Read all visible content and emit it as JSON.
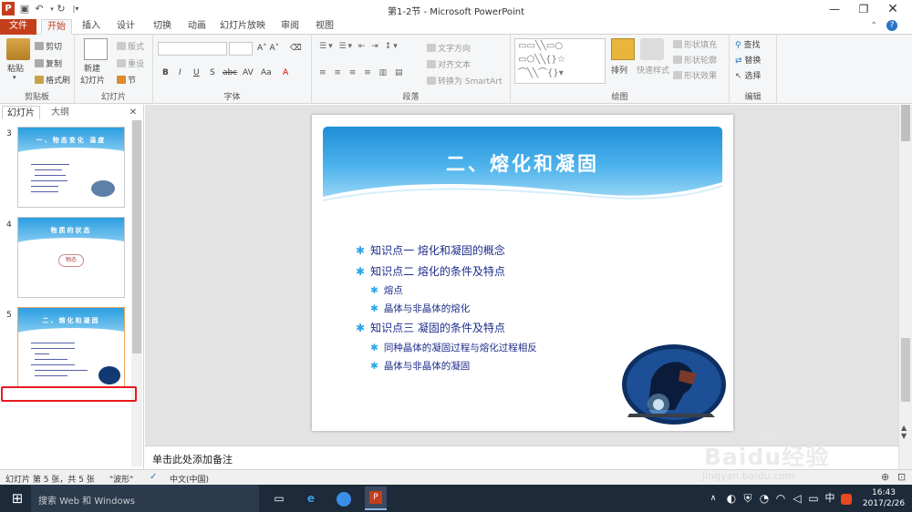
{
  "window": {
    "title": "第1-2节 - Microsoft PowerPoint",
    "help": "?"
  },
  "quick_access": [
    "save-icon",
    "undo-icon",
    "redo-icon",
    "customize-icon"
  ],
  "tabs": [
    "文件",
    "开始",
    "插入",
    "设计",
    "切换",
    "动画",
    "幻灯片放映",
    "审阅",
    "视图"
  ],
  "ribbon": {
    "clipboard": {
      "label": "剪贴板",
      "paste": "粘贴",
      "cut": "剪切",
      "copy": "复制",
      "format_painter": "格式刷"
    },
    "slides": {
      "label": "幻灯片",
      "new_slide": "新建",
      "new_slide2": "幻灯片",
      "layout": "版式",
      "reset": "重设",
      "section": "节"
    },
    "font": {
      "label": "字体",
      "btns": [
        "B",
        "I",
        "U",
        "S",
        "abc",
        "AV",
        "Aa",
        "A"
      ]
    },
    "paragraph": {
      "label": "段落",
      "text_direction": "文字方向",
      "align_text": "对齐文本",
      "smartart": "转换为 SmartArt"
    },
    "drawing": {
      "label": "绘图",
      "arrange": "排列",
      "quick_styles": "快速样式",
      "shape_fill": "形状填充",
      "shape_outline": "形状轮廓",
      "shape_effects": "形状效果"
    },
    "editing": {
      "label": "编辑",
      "find": "查找",
      "replace": "替换",
      "select": "选择"
    }
  },
  "left_pane": {
    "tabs": [
      "幻灯片",
      "大纲"
    ],
    "close": "✕",
    "slides": [
      {
        "num": "3",
        "title": "一、物态变化  温度"
      },
      {
        "num": "4",
        "title": "物质的状态",
        "tag": "物态"
      },
      {
        "num": "5",
        "title": "二、熔化和凝固"
      }
    ]
  },
  "slide": {
    "title": "二、熔化和凝固",
    "bullets": [
      {
        "level": 1,
        "text": "知识点一 熔化和凝固的概念"
      },
      {
        "level": 1,
        "text": "知识点二 熔化的条件及特点"
      },
      {
        "level": 2,
        "text": "熔点"
      },
      {
        "level": 2,
        "text": "晶体与非晶体的熔化"
      },
      {
        "level": 1,
        "text": "知识点三 凝固的条件及特点"
      },
      {
        "level": 2,
        "text": "同种晶体的凝固过程与熔化过程相反"
      },
      {
        "level": 2,
        "text": "晶体与非晶体的凝固"
      }
    ]
  },
  "notes": {
    "placeholder": "单击此处添加备注"
  },
  "status": {
    "slide_info": "幻灯片 第 5 张，共 5 张",
    "theme": "\"波形\"",
    "language": "中文(中国)"
  },
  "taskbar": {
    "search": "搜索 Web 和 Windows",
    "time": "16:43",
    "date": "2017/2/26",
    "ime": "中"
  },
  "watermark": {
    "text": "Baidu经验",
    "url": "jingyan.baidu.com"
  },
  "colors": {
    "accent": "#c43e1c",
    "slide_band": "#1f8ed6",
    "bullet_text": "#1e2d8a",
    "highlight": "#e8191f"
  }
}
